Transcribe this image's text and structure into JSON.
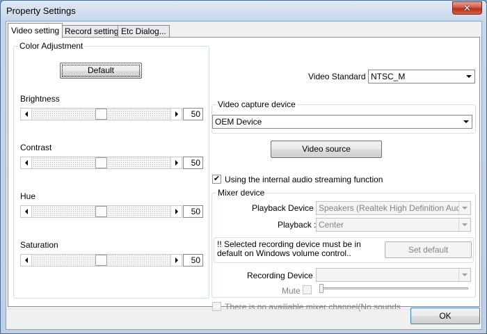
{
  "window": {
    "title": "Property Settings",
    "close_glyph": "✕"
  },
  "tabs": [
    {
      "label": "Video setting",
      "active": true
    },
    {
      "label": "Record setting",
      "active": false
    },
    {
      "label": "Etc Dialog...",
      "active": false
    }
  ],
  "color_adjustment": {
    "group_label": "Color Adjustment",
    "default_label": "Default",
    "sliders": [
      {
        "label": "Brightness",
        "value": "50",
        "level": 0.5
      },
      {
        "label": "Contrast",
        "value": "50",
        "level": 0.5
      },
      {
        "label": "Hue",
        "value": "50",
        "level": 0.5
      },
      {
        "label": "Saturation",
        "value": "50",
        "level": 0.5
      }
    ]
  },
  "video_standard": {
    "label": "Video Standard :",
    "value": "NTSC_M"
  },
  "capture_device": {
    "group_label": "Video capture device",
    "value": "OEM Device"
  },
  "video_source_label": "Video source",
  "audio_streaming": {
    "label": "Using the internal audio streaming function",
    "checked": true
  },
  "mixer": {
    "group_label": "Mixer device",
    "playback_device_label": "Playback Device :",
    "playback_device_value": "Speakers (Realtek High Definition Audio)",
    "playback_label": "Playback :",
    "playback_value": "Center",
    "notice": "!! Selected recording device must be in default on Windows volume control..",
    "set_default_label": "Set default",
    "recording_device_label": "Recording Device :",
    "recording_device_value": "",
    "mute_label": "Mute"
  },
  "no_mixer_channel": "There is no availiable mixer channel(No sounds",
  "ok_label": "OK",
  "colors": {
    "title_close": "#c7432e",
    "focus_border": "#707070"
  }
}
